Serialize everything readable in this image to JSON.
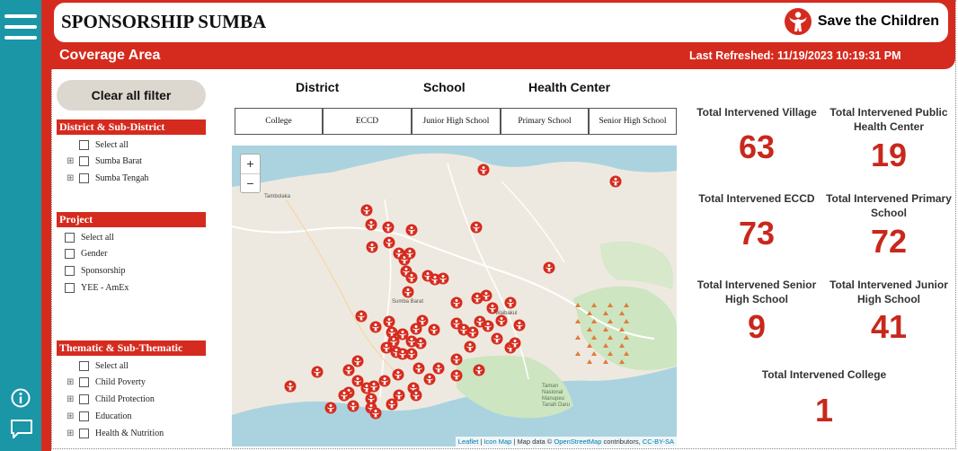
{
  "header": {
    "title": "SPONSORSHIP SUMBA",
    "logo_text": "Save the Children",
    "subtitle": "Coverage Area",
    "last_refreshed": "Last Refreshed: 11/19/2023 10:19:31 PM"
  },
  "filters": {
    "clear_label": "Clear all filter",
    "district": {
      "header": "District & Sub-District",
      "select_all": "Select all",
      "items": [
        {
          "label": "Sumba Barat",
          "expandable": true
        },
        {
          "label": "Sumba Tengah",
          "expandable": true
        }
      ]
    },
    "project": {
      "header": "Project",
      "select_all": "Select all",
      "items": [
        {
          "label": "Gender"
        },
        {
          "label": "Sponsorship"
        },
        {
          "label": "YEE - AmEx"
        }
      ]
    },
    "thematic": {
      "header": "Thematic & Sub-Thematic",
      "select_all": "Select all",
      "items": [
        {
          "label": "Child Poverty",
          "expandable": true
        },
        {
          "label": "Child Protection",
          "expandable": true
        },
        {
          "label": "Education",
          "expandable": true
        },
        {
          "label": "Health & Nutrition",
          "expandable": true
        }
      ]
    }
  },
  "tabs": [
    "District",
    "School",
    "Health Center"
  ],
  "school_levels": [
    "College",
    "ECCD",
    "Junior High School",
    "Primary School",
    "Senior High School"
  ],
  "map": {
    "zoom_in": "+",
    "zoom_out": "−",
    "place_labels": [
      "Tambolaka",
      "Sumba Barat",
      "Waibakul",
      "Taman Nasional Manupeu Tanah Daru"
    ],
    "attribution": {
      "leaflet": "Leaflet",
      "icon_map": "Icon Map",
      "text": "| Map data ©",
      "osm": "OpenStreetMap",
      "contributors": "contributors,",
      "license": "CC-BY-SA"
    }
  },
  "kpis": [
    {
      "label": "Total Intervened Village",
      "value": "63"
    },
    {
      "label": "Total Intervened Public Health Center",
      "value": "19"
    },
    {
      "label": "Total Intervened ECCD",
      "value": "73"
    },
    {
      "label": "Total Intervened Primary School",
      "value": "72"
    },
    {
      "label": "Total Intervened Senior High School",
      "value": "9"
    },
    {
      "label": "Total Intervened Junior High School",
      "value": "41"
    },
    {
      "label": "Total Intervened College",
      "value": "1"
    }
  ],
  "icons": {
    "menu": "hamburger-menu-icon",
    "info": "info-icon",
    "chat": "chat-icon",
    "marker": "save-the-children-marker-icon"
  },
  "colors": {
    "brand_red": "#d52b1e",
    "rail_teal": "#1a96a7",
    "kpi_red": "#c8281c",
    "button_beige": "#ddd8cf"
  }
}
